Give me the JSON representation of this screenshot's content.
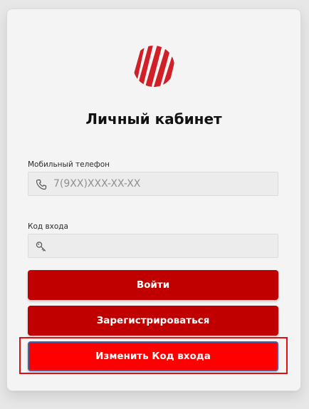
{
  "page": {
    "title": "Личный кабинет"
  },
  "phone": {
    "label": "Мобильный телефон",
    "placeholder": "7(9XX)XXX-XX-XX",
    "value": "",
    "icon": "phone-icon"
  },
  "code": {
    "label": "Код входа",
    "placeholder": "",
    "value": "",
    "icon": "key-icon"
  },
  "buttons": {
    "login": "Войти",
    "register": "Зарегистрироваться",
    "change_code": "Изменить Код входа"
  },
  "colors": {
    "primary": "#c00000",
    "primary_active": "#fe0000",
    "highlight_border": "#e01010"
  }
}
